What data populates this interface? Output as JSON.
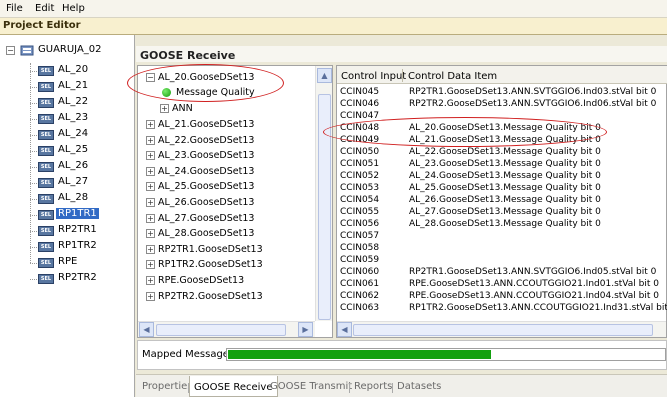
{
  "menu": {
    "file": "File",
    "edit": "Edit",
    "help": "Help"
  },
  "window": {
    "title": "Project Editor"
  },
  "project_tree": {
    "root": "GUARUJA_02",
    "items": [
      {
        "label": "AL_20",
        "selected": false
      },
      {
        "label": "AL_21",
        "selected": false
      },
      {
        "label": "AL_22",
        "selected": false
      },
      {
        "label": "AL_23",
        "selected": false
      },
      {
        "label": "AL_24",
        "selected": false
      },
      {
        "label": "AL_25",
        "selected": false
      },
      {
        "label": "AL_26",
        "selected": false
      },
      {
        "label": "AL_27",
        "selected": false
      },
      {
        "label": "AL_28",
        "selected": false
      },
      {
        "label": "RP1TR1",
        "selected": true
      },
      {
        "label": "RP2TR1",
        "selected": false
      },
      {
        "label": "RP1TR2",
        "selected": false
      },
      {
        "label": "RPE",
        "selected": false
      },
      {
        "label": "RP2TR2",
        "selected": false
      }
    ],
    "device_icon_text": "SEL"
  },
  "goose_receive": {
    "title": "GOOSE Receive",
    "datasets": {
      "expanded_item": "AL_20.GooseDSet13",
      "expanded_child": "Message Quality",
      "ann_item": "ANN",
      "items": [
        "AL_21.GooseDSet13",
        "AL_22.GooseDSet13",
        "AL_23.GooseDSet13",
        "AL_24.GooseDSet13",
        "AL_25.GooseDSet13",
        "AL_26.GooseDSet13",
        "AL_27.GooseDSet13",
        "AL_28.GooseDSet13",
        "RP2TR1.GooseDSet13",
        "RP1TR2.GooseDSet13",
        "RPE.GooseDSet13",
        "RP2TR2.GooseDSet13"
      ]
    },
    "table": {
      "col_input": "Control Input",
      "col_item": "Control Data Item",
      "rows": [
        {
          "input": "CCIN045",
          "item": "RP2TR1.GooseDSet13.ANN.SVTGGIO6.Ind03.stVal bit 0"
        },
        {
          "input": "CCIN046",
          "item": "RP2TR2.GooseDSet13.ANN.SVTGGIO6.Ind06.stVal bit 0"
        },
        {
          "input": "CCIN047",
          "item": ""
        },
        {
          "input": "CCIN048",
          "item": "AL_20.GooseDSet13.Message Quality bit 0"
        },
        {
          "input": "CCIN049",
          "item": "AL_21.GooseDSet13.Message Quality bit 0"
        },
        {
          "input": "CCIN050",
          "item": "AL_22.GooseDSet13.Message Quality bit 0"
        },
        {
          "input": "CCIN051",
          "item": "AL_23.GooseDSet13.Message Quality bit 0"
        },
        {
          "input": "CCIN052",
          "item": "AL_24.GooseDSet13.Message Quality bit 0"
        },
        {
          "input": "CCIN053",
          "item": "AL_25.GooseDSet13.Message Quality bit 0"
        },
        {
          "input": "CCIN054",
          "item": "AL_26.GooseDSet13.Message Quality bit 0"
        },
        {
          "input": "CCIN055",
          "item": "AL_27.GooseDSet13.Message Quality bit 0"
        },
        {
          "input": "CCIN056",
          "item": "AL_28.GooseDSet13.Message Quality bit 0"
        },
        {
          "input": "CCIN057",
          "item": ""
        },
        {
          "input": "CCIN058",
          "item": ""
        },
        {
          "input": "CCIN059",
          "item": ""
        },
        {
          "input": "CCIN060",
          "item": "RP2TR1.GooseDSet13.ANN.SVTGGIO6.Ind05.stVal bit 0"
        },
        {
          "input": "CCIN061",
          "item": "RPE.GooseDSet13.ANN.CCOUTGGIO21.Ind01.stVal bit 0"
        },
        {
          "input": "CCIN062",
          "item": "RPE.GooseDSet13.ANN.CCOUTGGIO21.Ind04.stVal bit 0"
        },
        {
          "input": "CCIN063",
          "item": "RP1TR2.GooseDSet13.ANN.CCOUTGGIO21.Ind31.stVal bit 0"
        }
      ]
    },
    "mapped_messages": {
      "label": "Mapped Messages",
      "progress": 0.6
    }
  },
  "tabs": [
    {
      "label": "Properties",
      "active": false
    },
    {
      "label": "GOOSE Receive",
      "active": true
    },
    {
      "label": "GOOSE Transmit",
      "active": false
    },
    {
      "label": "Reports",
      "active": false
    },
    {
      "label": "Datasets",
      "active": false
    }
  ],
  "colors": {
    "selection": "#316ac5",
    "progress_fill": "#13a00f",
    "annotation": "#d02020",
    "title_bar": "#f8f0cf"
  }
}
